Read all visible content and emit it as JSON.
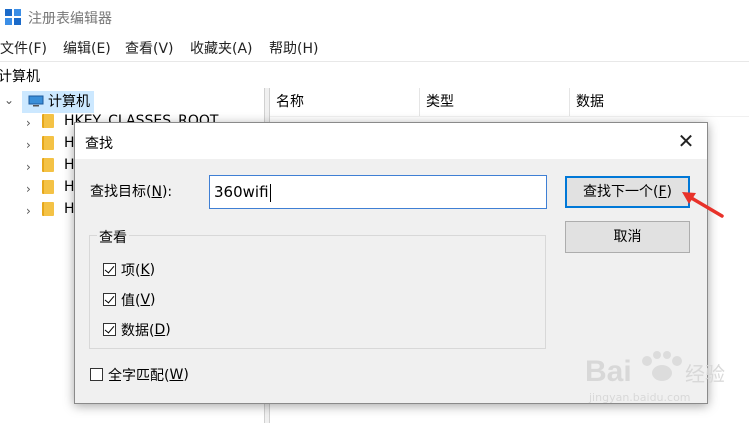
{
  "window": {
    "title": "注册表编辑器",
    "menu": [
      "文件(F)",
      "编辑(E)",
      "查看(V)",
      "收藏夹(A)",
      "帮助(H)"
    ],
    "address": "计算机"
  },
  "tree": {
    "root_label": "计算机",
    "nodes": [
      "HKEY_CLASSES_ROOT",
      "H",
      "H",
      "H",
      "H"
    ]
  },
  "list": {
    "columns": [
      "名称",
      "类型",
      "数据"
    ]
  },
  "dialog": {
    "title": "查找",
    "close_glyph": "✕",
    "find_label": "查找目标(",
    "find_label_key": "N",
    "find_label_end": "):",
    "find_value": "360wifi",
    "find_next_button": "查找下一个(",
    "find_next_key": "F",
    "find_next_end": ")",
    "cancel_button": "取消",
    "look_at_group": "查看",
    "checkboxes": [
      {
        "label": "项(",
        "key": "K",
        "end": ")",
        "checked": true
      },
      {
        "label": "值(",
        "key": "V",
        "end": ")",
        "checked": true
      },
      {
        "label": "数据(",
        "key": "D",
        "end": ")",
        "checked": true
      }
    ],
    "match_whole": {
      "label": "全字匹配(",
      "key": "W",
      "end": ")",
      "checked": false
    }
  },
  "watermark": {
    "brand": "Bai",
    "brand_suffix": "经验",
    "url": "jingyan.baidu.com"
  },
  "colors": {
    "selection": "#cce8ff",
    "focus_blue": "#0078d7",
    "annotation_arrow": "#e8322a",
    "folder": "#f4c245"
  }
}
